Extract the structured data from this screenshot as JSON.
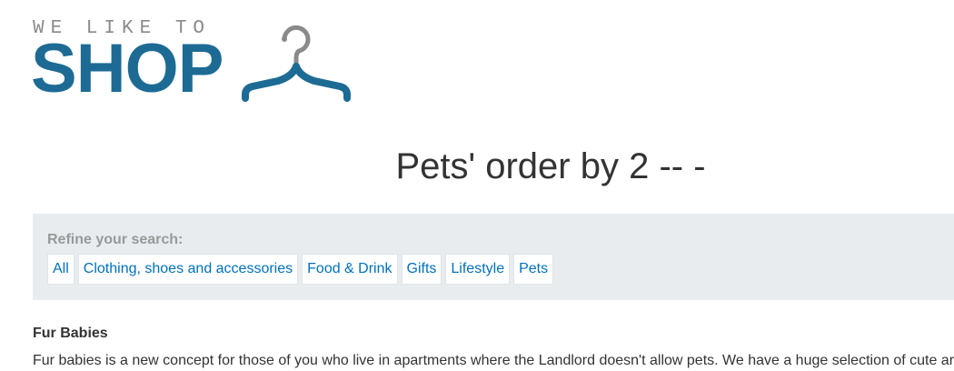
{
  "logo": {
    "tagline": "WE LIKE TO",
    "word": "SHOP",
    "brand_color": "#1d6b94",
    "tagline_color": "#8a8a8a",
    "icon": "hanger-icon"
  },
  "title": "Pets' order by 2 -- -",
  "filters": {
    "label": "Refine your search:",
    "items": [
      {
        "label": "All"
      },
      {
        "label": "Clothing, shoes and accessories"
      },
      {
        "label": "Food & Drink"
      },
      {
        "label": "Gifts"
      },
      {
        "label": "Lifestyle"
      },
      {
        "label": "Pets"
      }
    ],
    "link_color": "#0071bc",
    "panel_color": "#e8ecef"
  },
  "product": {
    "name": "Fur Babies",
    "description": "Fur babies is a new concept for those of you who live in apartments where the Landlord doesn't allow pets. We have a huge selection of cute ar"
  }
}
